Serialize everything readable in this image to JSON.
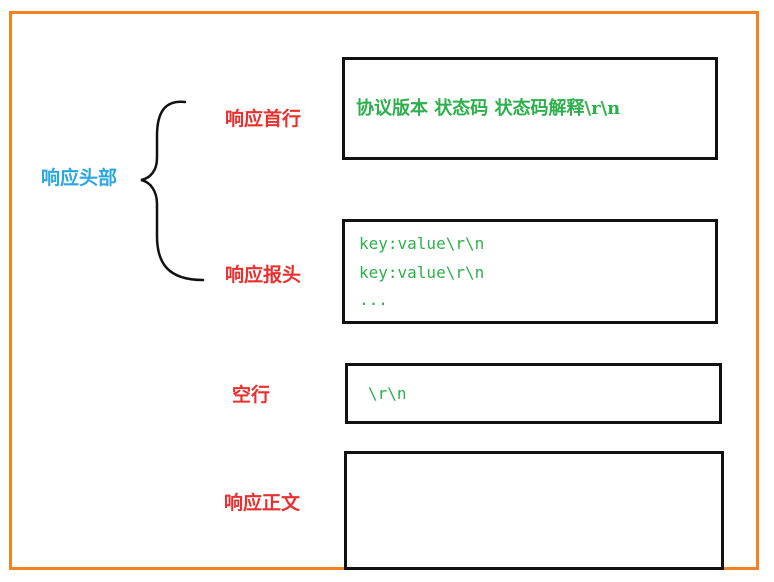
{
  "labels": {
    "response_header_group": "响应头部",
    "status_line": "响应首行",
    "response_headers": "响应报头",
    "blank_line": "空行",
    "response_body": "响应正文"
  },
  "boxes": {
    "status_line_content": "协议版本 状态码 状态码解释\\r\\n",
    "header_lines": [
      "key:value\\r\\n",
      "key:value\\r\\n",
      "..."
    ],
    "blank_line_content": "\\r\\n",
    "body_content": ""
  },
  "colors": {
    "frame": "#f58220",
    "label_red": "#e8312f",
    "label_blue": "#2aa7e0",
    "content_green": "#2db04b",
    "box_border": "#111111"
  }
}
